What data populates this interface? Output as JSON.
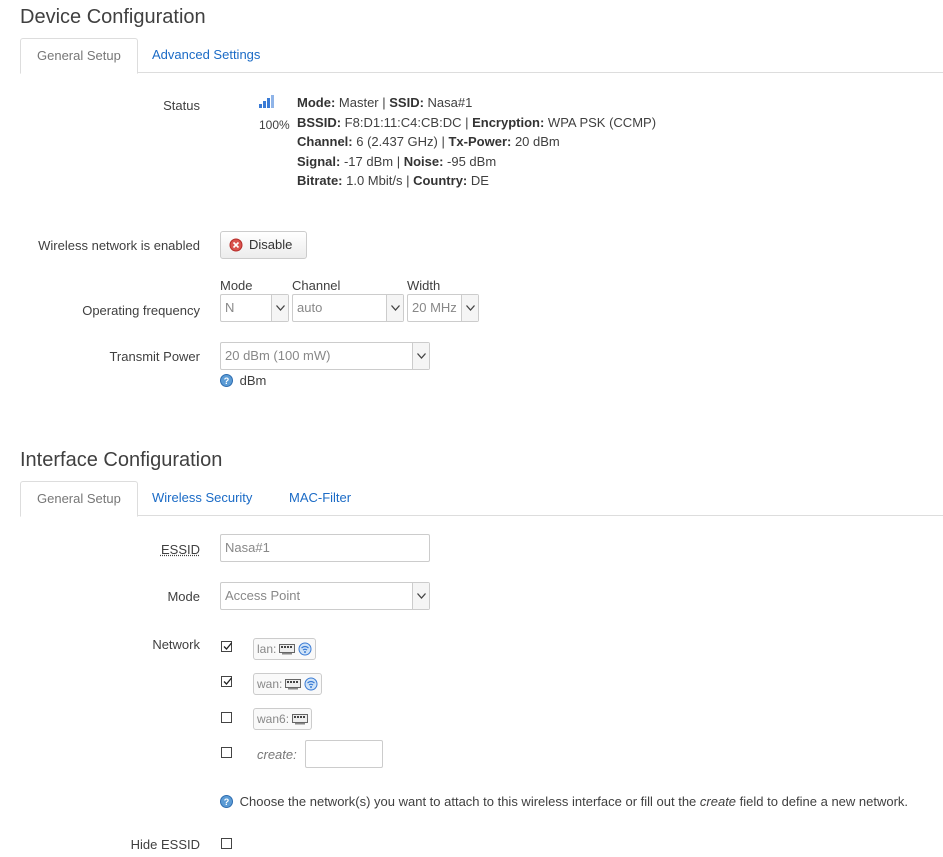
{
  "device": {
    "title": "Device Configuration",
    "tabs": [
      "General Setup",
      "Advanced Settings"
    ],
    "status": {
      "label": "Status",
      "signal_percent": "100%",
      "lines": [
        [
          {
            "k": "Mode:",
            "v": " Master | "
          },
          {
            "k": "SSID:",
            "v": " Nasa#1"
          }
        ],
        [
          {
            "k": "BSSID:",
            "v": " F8:D1:11:C4:CB:DC | "
          },
          {
            "k": "Encryption:",
            "v": " WPA PSK (CCMP)"
          }
        ],
        [
          {
            "k": "Channel:",
            "v": " 6 (2.437 GHz) | "
          },
          {
            "k": "Tx-Power:",
            "v": " 20 dBm"
          }
        ],
        [
          {
            "k": "Signal:",
            "v": " -17 dBm | "
          },
          {
            "k": "Noise:",
            "v": " -95 dBm"
          }
        ],
        [
          {
            "k": "Bitrate:",
            "v": " 1.0 Mbit/s | "
          },
          {
            "k": "Country:",
            "v": " DE"
          }
        ]
      ]
    },
    "wireless_enabled": {
      "label": "Wireless network is enabled",
      "button": "Disable"
    },
    "frequency": {
      "label": "Operating frequency",
      "mode": {
        "label": "Mode",
        "value": "N"
      },
      "channel": {
        "label": "Channel",
        "value": "auto"
      },
      "width": {
        "label": "Width",
        "value": "20 MHz"
      }
    },
    "tx_power": {
      "label": "Transmit Power",
      "value": "20 dBm (100 mW)",
      "help": "dBm"
    }
  },
  "interface": {
    "title": "Interface Configuration",
    "tabs": [
      "General Setup",
      "Wireless Security",
      "MAC-Filter"
    ],
    "essid": {
      "label": "ESSID",
      "value": "Nasa#1"
    },
    "mode": {
      "label": "Mode",
      "value": "Access Point"
    },
    "network": {
      "label": "Network",
      "items": [
        {
          "name": "lan:",
          "checked": true
        },
        {
          "name": "wan:",
          "checked": true
        },
        {
          "name": "wan6:",
          "checked": false
        }
      ],
      "create_label": "create:",
      "help_pre": "Choose the network(s) you want to attach to this wireless interface or fill out the ",
      "help_em": "create",
      "help_post": " field to define a new network."
    },
    "hide_essid": {
      "label": "Hide ESSID",
      "checked": false
    }
  }
}
